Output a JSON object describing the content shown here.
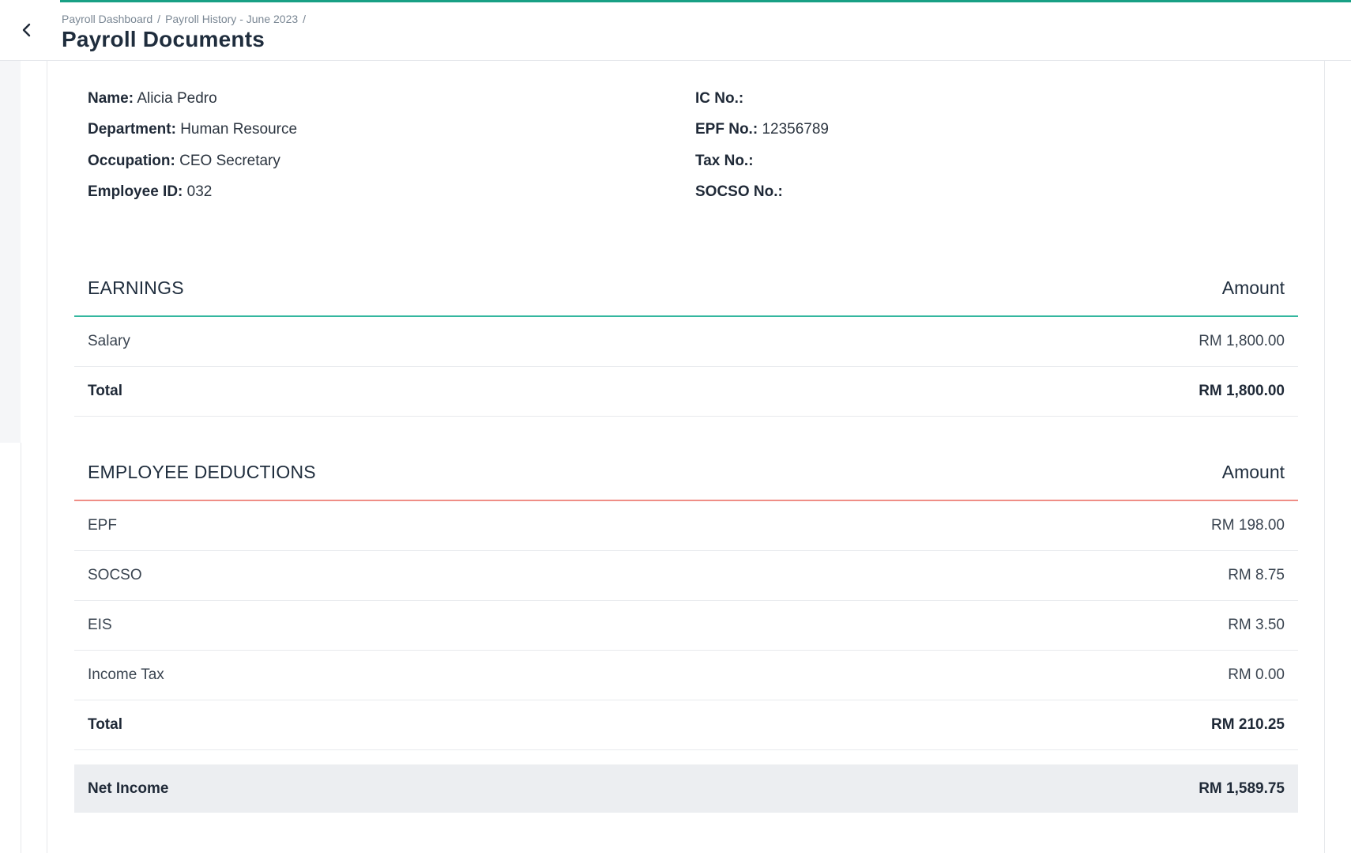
{
  "header": {
    "breadcrumb": [
      "Payroll Dashboard",
      "Payroll History - June 2023"
    ],
    "breadcrumb_sep": "/",
    "title": "Payroll Documents",
    "back_icon": "chevron-left-icon",
    "accent_color": "#18a085"
  },
  "employee": {
    "name_label": "Name:",
    "name": "Alicia Pedro",
    "department_label": "Department:",
    "department": "Human Resource",
    "occupation_label": "Occupation:",
    "occupation": "CEO Secretary",
    "employee_id_label": "Employee ID:",
    "employee_id": "032",
    "ic_label": "IC No.:",
    "ic": "",
    "epf_label": "EPF No.:",
    "epf": "12356789",
    "tax_label": "Tax No.:",
    "tax": "",
    "socso_label": "SOCSO No.:",
    "socso": ""
  },
  "earnings": {
    "title": "EARNINGS",
    "amount_header": "Amount",
    "rule_color": "#34b79f",
    "items": [
      {
        "label": "Salary",
        "amount": "RM 1,800.00"
      }
    ],
    "total_label": "Total",
    "total": "RM 1,800.00"
  },
  "deductions": {
    "title": "EMPLOYEE DEDUCTIONS",
    "amount_header": "Amount",
    "rule_color": "#ef8e86",
    "items": [
      {
        "label": "EPF",
        "amount": "RM 198.00"
      },
      {
        "label": "SOCSO",
        "amount": "RM 8.75"
      },
      {
        "label": "EIS",
        "amount": "RM 3.50"
      },
      {
        "label": "Income Tax",
        "amount": "RM 0.00"
      }
    ],
    "total_label": "Total",
    "total": "RM 210.25"
  },
  "net": {
    "label": "Net Income",
    "amount": "RM 1,589.75"
  }
}
